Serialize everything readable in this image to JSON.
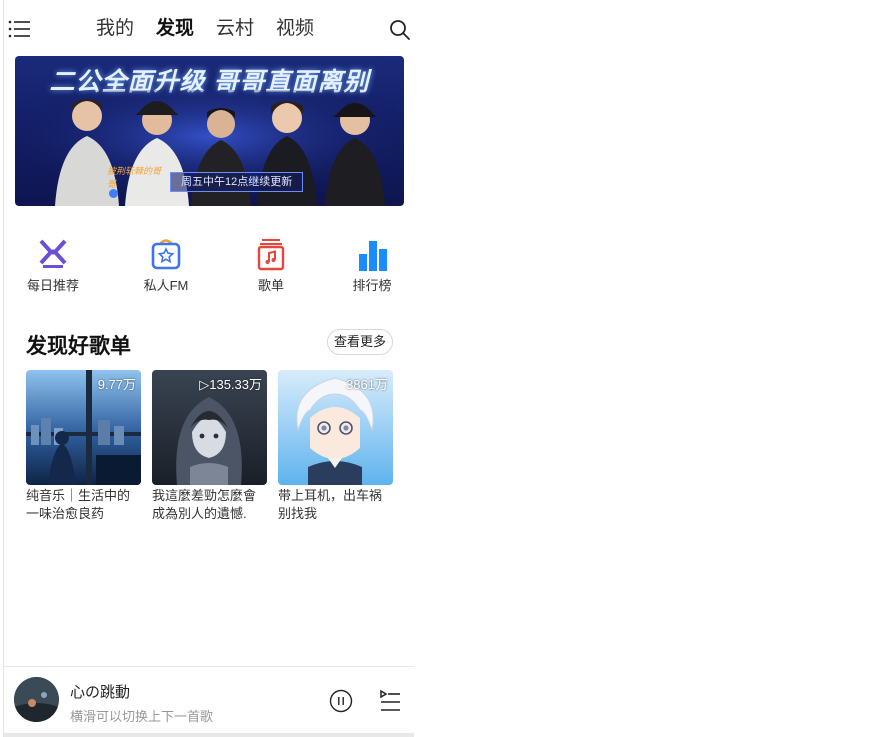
{
  "header": {
    "tabs": [
      {
        "label": "我的",
        "active": false
      },
      {
        "label": "发现",
        "active": true
      },
      {
        "label": "云村",
        "active": false
      },
      {
        "label": "视频",
        "active": false
      }
    ],
    "menu_icon": "hamburger-menu-icon",
    "search_icon": "search-icon"
  },
  "banner": {
    "headline": "二公全面升级 哥哥直面离别",
    "subtitle": "周五中午12点继续更新",
    "logo_text": "披荆斩棘的哥哥"
  },
  "quick_nav": [
    {
      "label": "每日推荐",
      "icon": "daily-recommend-icon",
      "color": "#6b4fd6"
    },
    {
      "label": "私人FM",
      "icon": "personal-fm-icon",
      "color": "#3d74f0"
    },
    {
      "label": "歌单",
      "icon": "playlist-icon",
      "color": "#e8453c"
    },
    {
      "label": "排行榜",
      "icon": "ranking-icon",
      "color": "#1a8cff"
    }
  ],
  "section": {
    "title": "发现好歌单",
    "more_label": "查看更多"
  },
  "playlists": [
    {
      "title": "纯音乐｜生活中的一味治愈良药",
      "plays": "9.77万"
    },
    {
      "title": "我這麼差勁怎麼會成為別人的遺憾.",
      "plays": "▷135.33万"
    },
    {
      "title": "带上耳机，出车祸别找我",
      "plays": "3861万"
    }
  ],
  "player": {
    "song_title": "心の跳動",
    "hint": "横滑可以切换上下一首歌",
    "pause_icon": "pause-circle-icon",
    "list_icon": "playlist-queue-icon"
  }
}
